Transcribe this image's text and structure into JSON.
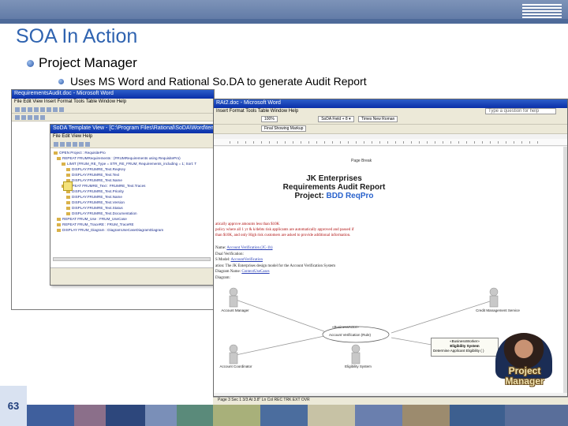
{
  "slide": {
    "title": "SOA In Action",
    "bullet1": "Project Manager",
    "bullet2": "Uses MS Word and Rational So.DA to generate Audit Report",
    "page_number": "63",
    "badge": {
      "line1": "Project",
      "line2": "Manager"
    }
  },
  "back_window": {
    "title": "RequirementsAudit.doc - Microsoft Word",
    "menu": "File  Edit  View  Insert  Format  Tools  Table  Window  Help"
  },
  "soda_window": {
    "title": "SoDA Template View - [C:\\Program Files\\Rational\\SoDA\\Word\\templates\\requirements\\aud",
    "menu": "File  Edit  View  Help",
    "tree": [
      "OPEN Project : RequisitePro",
      "REPEAT FRUMRequirements : (FRUMRequirements using RequisitePro)",
      "LIMIT (FRUM_RE_Type = STR_RE_FRUM; Requirements_including = 1; Sort: T",
      "DISPLAY.FRUMRE_Text.ReqKey",
      "DISPLAY.FRUMRE_Text.Text",
      "DISPLAY.FRUMRE_Text.Name",
      "REPEAT FRUMRE_Text : FRUMRE_Text.Traces",
      "DISPLAY.FRUMRE_Text.Priority",
      "DISPLAY.FRUMRE_Text.Name",
      "DISPLAY.FRUMRE_Text.Version",
      "DISPLAY.FRUMRE_Text.Status",
      "DISPLAY.FRUMRE_Text.Documentation",
      "REPEAT FRUM_Use : FRUM_UseCase",
      "REPEAT FRUM_TraceRE : FRUM_TraceRE",
      "DISPLAY FRUM_Diagram : DiagramUseCaseDiagramDiagram"
    ]
  },
  "main_window": {
    "title": "RAt2.doc - Microsoft Word",
    "menu": "Insert  Format  Tools  Table  Window  Help",
    "zoom": "100%",
    "style": "SoDA Field + 8 ▾",
    "font": "Times New Roman",
    "find": "Final Showing Markup",
    "help_placeholder": "Type a question for help",
    "page_break": "Page Break",
    "heading1": "JK Enterprises",
    "heading2": "Requirements Audit Report",
    "heading3_prefix": "Project: ",
    "heading3_project": "BDD ReqPro",
    "red_lines": [
      "atically approve amounts less than $10K",
      "policy where all 1 yr & k/debts risk applicants are automatically approved and passed if",
      "than $10K, and only High risk customers are asked to provide additional information."
    ],
    "list": [
      {
        "label": "Name: ",
        "value": "Account Verification (JC-1b)"
      },
      {
        "label": "",
        "value": "Dual Verification:"
      },
      {
        "label": "",
        "value": "S Model: ",
        "link": "AccountVerification"
      },
      {
        "label": "",
        "value": "ation: The JK Enterprises design model for the Account Verification System"
      },
      {
        "label": "Diagram Name: ",
        "link": "ContextUseCases"
      },
      {
        "label": "",
        "value": "Diagram:"
      }
    ],
    "diagram": {
      "actor1": "Account Manager",
      "actor2": "Account Coordinator",
      "usecase1": "«BusinessActor»",
      "uc_center": "Account Verification (Rule)",
      "actor3": "Credit Management Service",
      "actor4": "Eligibility System",
      "sys_box_title": "«BusinessWorker»",
      "sys_box_line1": "Eligibility System",
      "sys_box_line2": "Determine Applicant Eligibility ( )"
    }
  },
  "status_bar": {
    "text": "Page 3   Sec 1   3/3   At 3.8\"   Ln   Col   REC  TRK  EXT  OVR"
  },
  "colors": {
    "title_blue": "#2f63b0",
    "header_bar": "#6a82ad",
    "word_titlebar": "#0a2fa8",
    "red_text": "#b01010",
    "badge_text": "#f0e2b0"
  }
}
